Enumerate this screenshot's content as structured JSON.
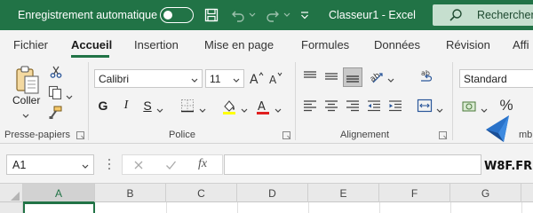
{
  "titlebar": {
    "autosave_label": "Enregistrement automatique",
    "autosave_on": false,
    "doc_title": "Classeur1  -  Excel",
    "search_label": "Rechercher",
    "color": "#217346"
  },
  "tabs": [
    {
      "label": "Fichier",
      "active": false
    },
    {
      "label": "Accueil",
      "active": true
    },
    {
      "label": "Insertion",
      "active": false
    },
    {
      "label": "Mise en page",
      "active": false
    },
    {
      "label": "Formules",
      "active": false
    },
    {
      "label": "Données",
      "active": false
    },
    {
      "label": "Révision",
      "active": false
    },
    {
      "label": "Affi",
      "active": false
    }
  ],
  "ribbon": {
    "clipboard": {
      "group_label": "Presse-papiers",
      "paste_label": "Coller"
    },
    "font": {
      "group_label": "Police",
      "font_name": "Calibri",
      "font_size": "11",
      "bold": "G",
      "italic": "I",
      "underline": "S"
    },
    "alignment": {
      "group_label": "Alignement"
    },
    "number": {
      "group_label": "mbre",
      "format": "Standard",
      "percent": "%"
    }
  },
  "formula_bar": {
    "namebox_value": "A1",
    "fx_label": "fx",
    "formula_value": ""
  },
  "watermark": "W8F.FR",
  "grid": {
    "columns": [
      "A",
      "B",
      "C",
      "D",
      "E",
      "F",
      "G"
    ],
    "active_column": "A"
  }
}
